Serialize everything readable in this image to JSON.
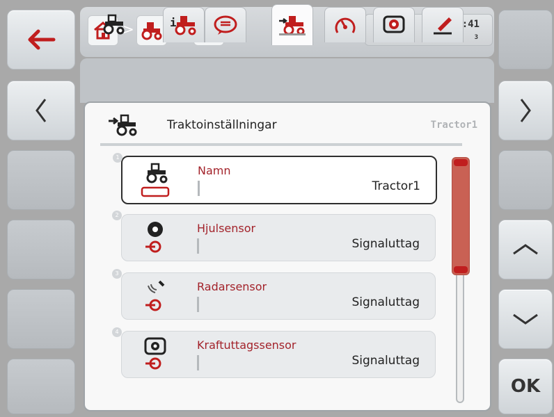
{
  "header": {
    "time": "10:41",
    "number": "3"
  },
  "panel": {
    "title": "Traktoinställningar",
    "subtitle": "Tractor1"
  },
  "rows": [
    {
      "index": "1",
      "label": "Namn",
      "value": "Tractor1",
      "icon": "tractor-icon"
    },
    {
      "index": "2",
      "label": "Hjulsensor",
      "value": "Signaluttag",
      "icon": "wheel-sensor-icon"
    },
    {
      "index": "3",
      "label": "Radarsensor",
      "value": "Signaluttag",
      "icon": "radar-sensor-icon"
    },
    {
      "index": "4",
      "label": "Kraftuttagssensor",
      "value": "Signaluttag",
      "icon": "pto-sensor-icon"
    }
  ],
  "buttons": {
    "ok_label": "OK"
  },
  "tabs": [
    {
      "icon": "tractor-icon"
    },
    {
      "icon": "tractor-info-icon"
    },
    {
      "icon": "speech-bubble-icon"
    },
    {
      "icon": "tractor-settings-icon"
    },
    {
      "icon": "speedometer-icon"
    },
    {
      "icon": "pto-icon"
    },
    {
      "icon": "pencil-icon"
    }
  ],
  "colors": {
    "accent_red": "#c01e1e",
    "label_red": "#a3232b",
    "scrollbar": "#c96154"
  }
}
